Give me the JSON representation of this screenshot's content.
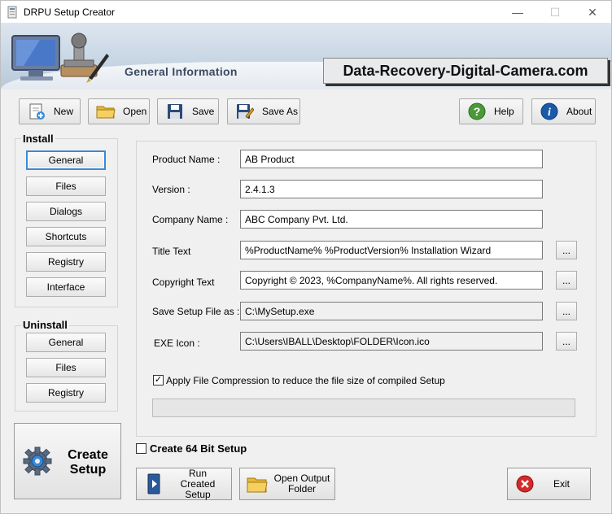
{
  "window": {
    "title": "DRPU Setup Creator",
    "minimize": "—",
    "maximize": "☐",
    "close": "✕"
  },
  "banner": {
    "heading": "General Information",
    "website": "Data-Recovery-Digital-Camera.com"
  },
  "toolbar": {
    "new_label": "New",
    "open_label": "Open",
    "save_label": "Save",
    "save_as_label": "Save As",
    "help_label": "Help",
    "about_label": "About"
  },
  "install": {
    "title": "Install",
    "items": [
      "General",
      "Files",
      "Dialogs",
      "Shortcuts",
      "Registry",
      "Interface"
    ],
    "selected": "General"
  },
  "uninstall": {
    "title": "Uninstall",
    "items": [
      "General",
      "Files",
      "Registry"
    ]
  },
  "form": {
    "product_name": {
      "label": "Product Name :",
      "value": "AB Product"
    },
    "version": {
      "label": "Version :",
      "value": "2.4.1.3"
    },
    "company_name": {
      "label": "Company Name :",
      "value": "ABC Company Pvt. Ltd."
    },
    "title_text": {
      "label": "Title Text",
      "value": "%ProductName% %ProductVersion% Installation Wizard"
    },
    "copyright_text": {
      "label": "Copyright Text",
      "value": "Copyright © 2023, %CompanyName%. All rights reserved."
    },
    "save_setup": {
      "label": "Save Setup File as :",
      "value": "C:\\MySetup.exe"
    },
    "exe_icon": {
      "label": "EXE Icon :",
      "value": "C:\\Users\\IBALL\\Desktop\\FOLDER\\Icon.ico"
    },
    "browse_label": "...",
    "compression": {
      "label": "Apply File Compression to reduce the file size of compiled Setup",
      "checked": true,
      "mark": "✓"
    },
    "progress": 0
  },
  "bottom": {
    "bit64": {
      "label": "Create 64 Bit Setup",
      "checked": false
    },
    "create_setup_label": "Create Setup",
    "run_created_label": "Run Created Setup",
    "open_output_label": "Open Output Folder",
    "exit_label": "Exit"
  },
  "colors": {
    "accent": "#3a8ad4",
    "help_green": "#4a9a3a",
    "about_blue": "#1a5aa8",
    "exit_red": "#d42a2a"
  }
}
